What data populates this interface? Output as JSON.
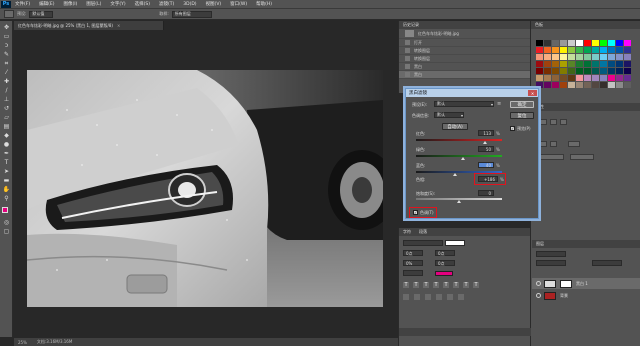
{
  "app": {
    "logo": "Ps"
  },
  "menu": [
    "文件(F)",
    "编辑(E)",
    "图像(I)",
    "图层(L)",
    "文字(Y)",
    "选择(S)",
    "滤镜(T)",
    "3D(D)",
    "视图(V)",
    "窗口(W)",
    "帮助(H)"
  ],
  "options": {
    "mode_label": "预设:",
    "mode_value": "默认值",
    "sample_label": "取样:",
    "sample_value": "所有图层"
  },
  "document": {
    "tab_title": "红色车车炫彩-明暗.jpg @ 25% (黑白 1, 图层蒙版/8)",
    "status_zoom": "25%",
    "status_doc": "文档:3.16M/3.16M"
  },
  "history_panel": {
    "tab_label": "历史记录",
    "snapshot": "红色车车炫彩-明暗.jpg",
    "items": [
      "打开",
      "转换图层",
      "转换图层",
      "黑白",
      "黑白"
    ]
  },
  "swatches_panel": {
    "tab_label": "色板",
    "colors": [
      "#000000",
      "#333333",
      "#666666",
      "#999999",
      "#cccccc",
      "#ffffff",
      "#ff0000",
      "#ffff00",
      "#00ff00",
      "#00ffff",
      "#0000ff",
      "#ff00ff",
      "#ed1c24",
      "#f26522",
      "#f7941d",
      "#fff200",
      "#8dc63f",
      "#39b54a",
      "#00a651",
      "#00a99d",
      "#00aeef",
      "#0072bc",
      "#0054a6",
      "#2e3192",
      "#f69679",
      "#f9ad81",
      "#fdc689",
      "#fff799",
      "#c4df9b",
      "#a3d39c",
      "#82ca9c",
      "#7accc8",
      "#6dcff6",
      "#7da7d9",
      "#8393ca",
      "#8781bd",
      "#9e0b0f",
      "#a0410d",
      "#a36209",
      "#aba000",
      "#598527",
      "#1a7b30",
      "#007236",
      "#00746b",
      "#0076a3",
      "#004b80",
      "#003471",
      "#1b1464",
      "#790000",
      "#7b2e00",
      "#7d4900",
      "#827b00",
      "#406618",
      "#005e20",
      "#005826",
      "#005952",
      "#005b7f",
      "#003663",
      "#002157",
      "#0d004c",
      "#c69c6d",
      "#a67c52",
      "#8c6239",
      "#754c24",
      "#603913",
      "#f5989d",
      "#bd8cbf",
      "#a186be",
      "#8882be",
      "#ec008c",
      "#92278f",
      "#662d91",
      "#440e62",
      "#630460",
      "#9e005d",
      "#a0410d",
      "#c7b299",
      "#998675",
      "#736357",
      "#534741",
      "#362f2d",
      "#c2c2c2",
      "#8a8a8a",
      "#5e5e5e"
    ]
  },
  "adjustments_panel": {
    "tab_label": "属性"
  },
  "properties_panel": {
    "tab_a": "字符",
    "tab_b": "段落",
    "fields": [
      "0点",
      "0点",
      "0%",
      "0点"
    ]
  },
  "layers_panel": {
    "tab_label": "图层",
    "layers": [
      {
        "name": "黑白 1",
        "selected": true
      },
      {
        "name": "背景",
        "selected": false
      }
    ]
  },
  "dialog": {
    "title": "黑白滤镜",
    "preset_label": "预设(E):",
    "preset_value": "默认",
    "channel_label": "色调信息:",
    "channel_value": "默认",
    "ok_label": "确定",
    "cancel_label": "复位",
    "auto_label": "自动(A)",
    "preview_label": "预览(P)",
    "preview_checked": true,
    "tint_label": "色调(T)",
    "tint_checked": true,
    "section_label": "渐变编辑",
    "sliders": [
      {
        "label": "红色:",
        "value": "113",
        "unit": "%",
        "fraction": 0.8,
        "track": "red-cyan"
      },
      {
        "label": "绿色:",
        "value": "50",
        "unit": "%",
        "fraction": 0.55,
        "track": "green-magenta"
      },
      {
        "label": "蓝色:",
        "value": "40",
        "unit": "%",
        "fraction": 0.45,
        "track": "blue-yellow"
      }
    ],
    "hue_label": "色相:",
    "hue_value": "+186",
    "hue_unit": "%",
    "saturation_label": "饱和度(S):",
    "saturation_value": "0",
    "saturation_fraction": 0.5,
    "highlight_color": "#e0141e"
  }
}
